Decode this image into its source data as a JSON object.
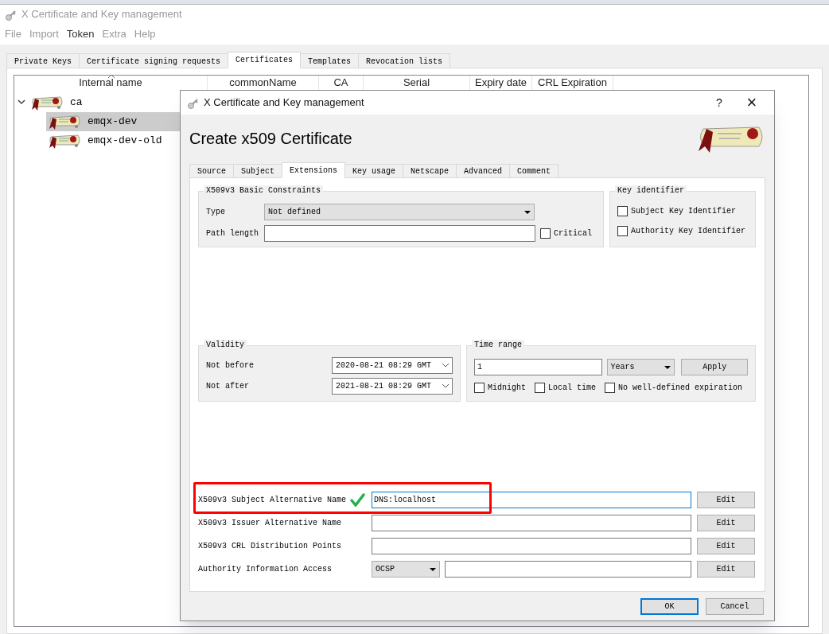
{
  "window": {
    "title": "X Certificate and Key management"
  },
  "menu": [
    {
      "label": "File",
      "disabled": true
    },
    {
      "label": "Import",
      "disabled": true
    },
    {
      "label": "Token",
      "disabled": false
    },
    {
      "label": "Extra",
      "disabled": true
    },
    {
      "label": "Help",
      "disabled": true
    }
  ],
  "tabs": [
    {
      "label": "Private Keys",
      "selected": false
    },
    {
      "label": "Certificate signing requests",
      "selected": false
    },
    {
      "label": "Certificates",
      "selected": true
    },
    {
      "label": "Templates",
      "selected": false
    },
    {
      "label": "Revocation lists",
      "selected": false
    }
  ],
  "table": {
    "columns": [
      "Internal name",
      "commonName",
      "CA",
      "Serial",
      "Expiry date",
      "CRL Expiration"
    ],
    "tree": [
      {
        "name": "ca",
        "expanded": true,
        "selected": false,
        "children": [
          {
            "name": "emqx-dev",
            "selected": true
          },
          {
            "name": "emqx-dev-old",
            "selected": false
          }
        ]
      }
    ]
  },
  "dialog": {
    "title": "X Certificate and Key management",
    "help": "?",
    "close": "×",
    "heading": "Create x509 Certificate",
    "tabs": [
      {
        "label": "Source",
        "selected": false
      },
      {
        "label": "Subject",
        "selected": false
      },
      {
        "label": "Extensions",
        "selected": true
      },
      {
        "label": "Key usage",
        "selected": false
      },
      {
        "label": "Netscape",
        "selected": false
      },
      {
        "label": "Advanced",
        "selected": false
      },
      {
        "label": "Comment",
        "selected": false
      }
    ],
    "basic_constraints": {
      "title": "X509v3 Basic Constraints",
      "type_label": "Type",
      "type_value": "Not defined",
      "path_length_label": "Path length",
      "critical": {
        "label": "Critical",
        "checked": false
      }
    },
    "key_identifier": {
      "title": "Key identifier",
      "options": [
        {
          "label": "Subject Key Identifier",
          "checked": false
        },
        {
          "label": "Authority Key Identifier",
          "checked": false
        }
      ]
    },
    "validity": {
      "title": "Validity",
      "rows": [
        {
          "label": "Not before",
          "value": "2020-08-21 08:29 GMT"
        },
        {
          "label": "Not after",
          "value": "2021-08-21 08:29 GMT"
        }
      ]
    },
    "time_range": {
      "title": "Time range",
      "amount": "1",
      "unit": "Years",
      "apply": "Apply",
      "options": [
        {
          "label": "Midnight",
          "checked": false
        },
        {
          "label": "Local time",
          "checked": false
        },
        {
          "label": "No well-defined expiration",
          "checked": false
        }
      ]
    },
    "extensions": [
      {
        "kind": "text",
        "label": "X509v3 Subject Alternative Name",
        "value": "DNS:localhost",
        "valid": true,
        "focused": true,
        "highlighted": true,
        "edit": "Edit"
      },
      {
        "kind": "text",
        "label": "X509v3 Issuer Alternative Name",
        "valid": false,
        "focused": false,
        "highlighted": false,
        "edit": "Edit"
      },
      {
        "kind": "text",
        "label": "X509v3 CRL Distribution Points",
        "valid": false,
        "focused": false,
        "highlighted": false,
        "edit": "Edit"
      },
      {
        "kind": "method",
        "label": "Authority Information Access",
        "method": "OCSP",
        "valid": false,
        "focused": false,
        "highlighted": false,
        "edit": "Edit"
      }
    ],
    "buttons": [
      {
        "label": "OK",
        "default": true
      },
      {
        "label": "Cancel",
        "default": false
      }
    ]
  }
}
